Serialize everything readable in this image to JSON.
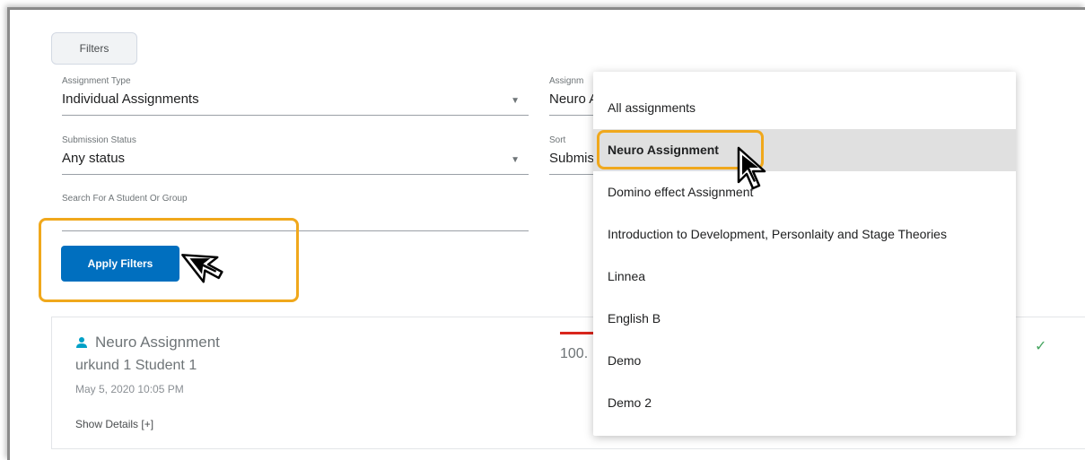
{
  "filters_button": {
    "label": "Filters"
  },
  "assignment_type": {
    "label": "Assignment Type",
    "value": "Individual Assignments"
  },
  "assignment": {
    "label": "Assignm",
    "value": "Neuro A"
  },
  "submission_status": {
    "label": "Submission Status",
    "value": "Any status"
  },
  "sort": {
    "label": "Sort",
    "value": "Submis"
  },
  "search": {
    "label": "Search For A Student Or Group",
    "value": ""
  },
  "apply_button": {
    "label": "Apply Filters"
  },
  "result": {
    "title": "Neuro Assignment",
    "student": "urkund 1 Student 1",
    "date": "May 5, 2020 10:05 PM",
    "details_link": "Show Details [+]",
    "score": "100.",
    "check": "✓"
  },
  "dropdown": {
    "items": [
      {
        "label": "All assignments"
      },
      {
        "label": "Neuro Assignment",
        "selected": true
      },
      {
        "label": "Domino effect Assignment"
      },
      {
        "label": "Introduction to Development, Personlaity and Stage Theories"
      },
      {
        "label": "Linnea"
      },
      {
        "label": "English B"
      },
      {
        "label": "Demo"
      },
      {
        "label": "Demo 2"
      }
    ]
  },
  "colors": {
    "primary": "#006fbf",
    "highlight": "#f0a81c",
    "selected_bg": "#e0e0e0",
    "score_bar": "#d9261c",
    "check": "#46a661",
    "person_icon": "#00a0c6"
  },
  "icons": {
    "caret": "caret-down-icon",
    "person": "person-icon",
    "check": "check-icon",
    "cursor": "mouse-cursor-icon"
  }
}
